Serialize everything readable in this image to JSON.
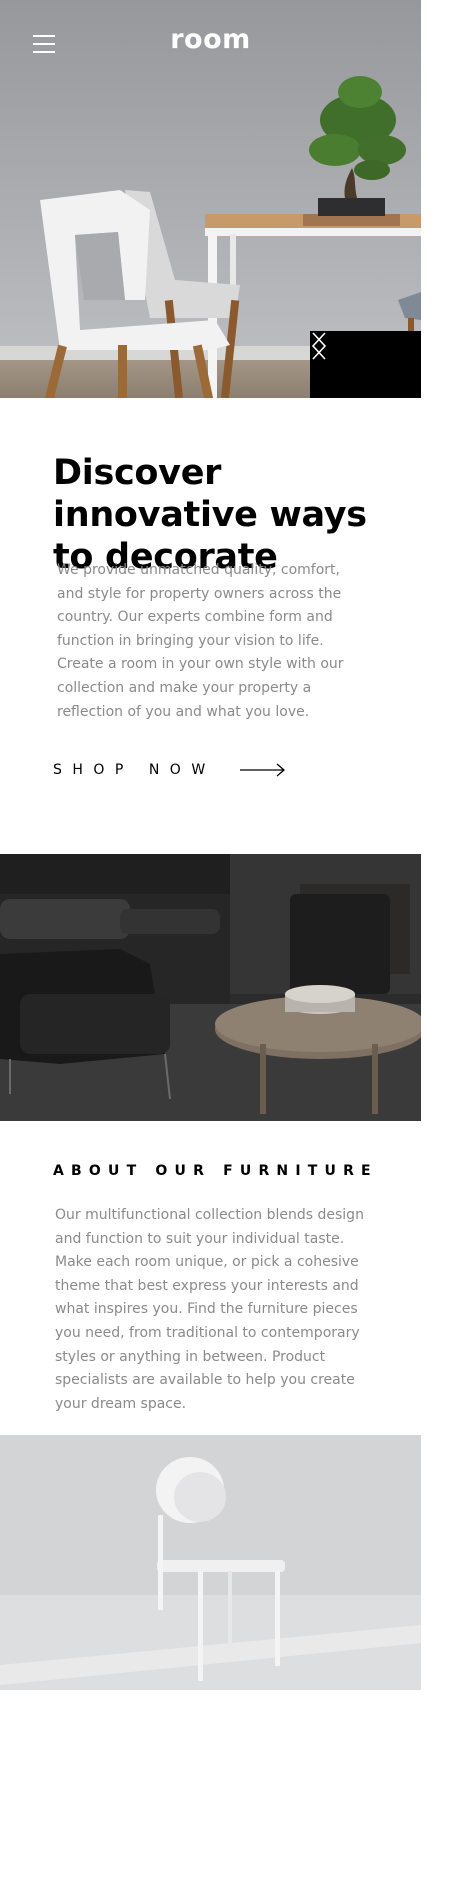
{
  "header": {
    "logo": "room",
    "menu_icon": "hamburger-menu-icon"
  },
  "hero": {
    "image_subject": "white chairs beside a wooden table with a bonsai tree",
    "prev_icon": "chevron-left-icon",
    "next_icon": "chevron-right-icon"
  },
  "discover": {
    "headline": "Discover innovative ways to decorate",
    "body": "We provide unmatched quality, comfort, and style for property owners across the country. Our experts combine form and function in bringing your vision to life. Create a room in your own style with our collection and make your property a reflection of you and what you love.",
    "cta_label": "SHOP NOW",
    "cta_icon": "arrow-right-icon"
  },
  "dark_image": {
    "image_subject": "dark room with armchair and round coffee table"
  },
  "about": {
    "title": "ABOUT OUR FURNITURE",
    "body": "Our multifunctional collection blends design and function to suit your individual taste. Make each room unique, or pick a cohesive theme that best express your interests and what inspires you. Find the furniture pieces you need, from traditional to contemporary styles or anything in between. Product specialists are available to help you create your dream space."
  },
  "light_image": {
    "image_subject": "white chair in a light grey room"
  },
  "colors": {
    "text_primary": "#000000",
    "text_secondary": "#8a8a8a",
    "background": "#ffffff",
    "slider_bg": "#000000"
  }
}
